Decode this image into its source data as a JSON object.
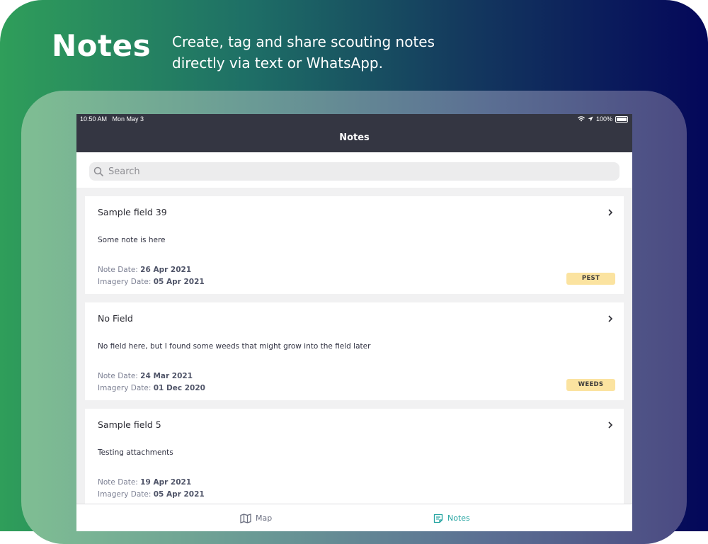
{
  "promo": {
    "title": "Notes",
    "subtitle": "Create, tag and share scouting notes directly via text or WhatsApp."
  },
  "status_bar": {
    "time": "10:50 AM",
    "date": "Mon May 3",
    "battery": "100%"
  },
  "nav": {
    "title": "Notes"
  },
  "search": {
    "placeholder": "Search",
    "value": ""
  },
  "notes": [
    {
      "field": "Sample field 39",
      "text": "Some note is here",
      "note_date_label": "Note Date:",
      "note_date": "26 Apr 2021",
      "imagery_date_label": "Imagery Date:",
      "imagery_date": "05 Apr 2021",
      "tag": "PEST"
    },
    {
      "field": "No Field",
      "text": "No field here, but I found some weeds that might grow into the field later",
      "note_date_label": "Note Date:",
      "note_date": "24 Mar 2021",
      "imagery_date_label": "Imagery Date:",
      "imagery_date": "01 Dec 2020",
      "tag": "WEEDS"
    },
    {
      "field": "Sample field 5",
      "text": "Testing attachments",
      "note_date_label": "Note Date:",
      "note_date": "19 Apr 2021",
      "imagery_date_label": "Imagery Date:",
      "imagery_date": "05 Apr 2021",
      "tag": ""
    }
  ],
  "tabs": [
    {
      "label": "Map",
      "icon": "map-icon",
      "active": false
    },
    {
      "label": "Notes",
      "icon": "notes-icon",
      "active": true
    }
  ],
  "colors": {
    "nav_bg": "#343642",
    "accent": "#22a3a0",
    "tag_bg": "#fbe3a0"
  }
}
